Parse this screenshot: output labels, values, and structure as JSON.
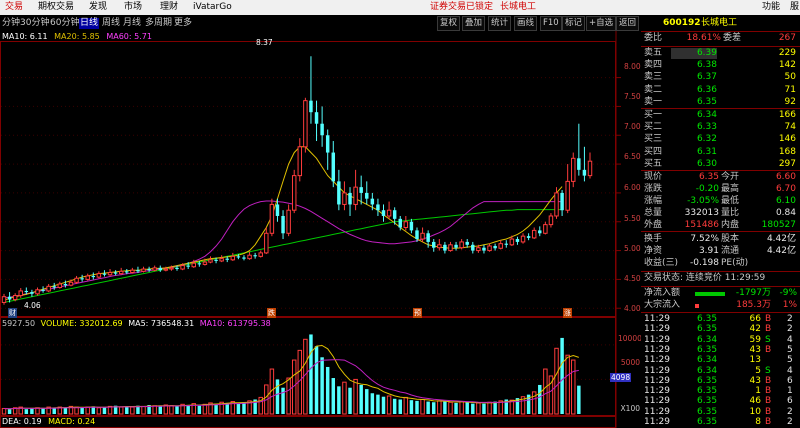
{
  "menu": {
    "items": [
      {
        "label": "交易",
        "active": true
      },
      {
        "label": "期权交易"
      },
      {
        "label": "发现"
      },
      {
        "label": "市场"
      },
      {
        "label": "理财"
      },
      {
        "label": "iVatarGo"
      }
    ],
    "notice_lock": "证券交易已锁定",
    "notice_stock": "长城电工",
    "right": [
      "功能",
      "服"
    ]
  },
  "periods": [
    "分钟",
    "30分钟",
    "60分钟",
    "日线",
    "周线",
    "月线",
    "多周期",
    "更多"
  ],
  "selected_period": "日线",
  "toolbar": [
    "复权",
    "叠加",
    "统计",
    "画线",
    "F10",
    "标记",
    "+自选",
    "返回"
  ],
  "legends": {
    "ma": [
      {
        "text": "MA10: 6.11",
        "color": "#ffffff"
      },
      {
        "text": "MA20: 5.85",
        "color": "#e0c000"
      },
      {
        "text": "MA60: 5.71",
        "color": "#ff40ff"
      }
    ],
    "vol": [
      {
        "text": "5927.50",
        "color": "#c8c8c8"
      },
      {
        "text": "VOLUME: 332012.69",
        "color": "#ffff00"
      },
      {
        "text": "MA5: 736548.31",
        "color": "#ffffff"
      },
      {
        "text": "MA10: 613795.38",
        "color": "#ff40ff"
      }
    ],
    "macd": [
      {
        "text": "DEA: 0.19",
        "color": "#ffffff"
      },
      {
        "text": "MACD: 0.24",
        "color": "#ffff00"
      }
    ]
  },
  "price_axis": [
    "8.00",
    "7.50",
    "7.00",
    "6.50",
    "6.00",
    "5.50",
    "5.00",
    "4.50",
    "4.00"
  ],
  "vol_axis": [
    "10000",
    "5000",
    "X100"
  ],
  "vol_marker": "4098",
  "annotations": {
    "high": "8.37",
    "low": "4.06",
    "markers": [
      "财",
      "跌",
      "预",
      "涨"
    ]
  },
  "chart_data": {
    "type": "candlestick",
    "ylim": [
      3.9,
      8.6
    ],
    "candles": [
      [
        4.1,
        4.2,
        4.25,
        4.06
      ],
      [
        4.2,
        4.15,
        4.28,
        4.1
      ],
      [
        4.15,
        4.22,
        4.26,
        4.12
      ],
      [
        4.22,
        4.3,
        4.35,
        4.18
      ],
      [
        4.3,
        4.28,
        4.36,
        4.24
      ],
      [
        4.28,
        4.25,
        4.32,
        4.2
      ],
      [
        4.25,
        4.32,
        4.36,
        4.22
      ],
      [
        4.32,
        4.3,
        4.38,
        4.27
      ],
      [
        4.3,
        4.38,
        4.42,
        4.28
      ],
      [
        4.38,
        4.36,
        4.44,
        4.32
      ],
      [
        4.36,
        4.42,
        4.46,
        4.34
      ],
      [
        4.42,
        4.4,
        4.48,
        4.36
      ],
      [
        4.4,
        4.45,
        4.5,
        4.38
      ],
      [
        4.45,
        4.52,
        4.56,
        4.42
      ],
      [
        4.52,
        4.5,
        4.58,
        4.46
      ],
      [
        4.5,
        4.56,
        4.6,
        4.48
      ],
      [
        4.56,
        4.54,
        4.62,
        4.5
      ],
      [
        4.54,
        4.6,
        4.64,
        4.52
      ],
      [
        4.6,
        4.58,
        4.66,
        4.55
      ],
      [
        4.58,
        4.62,
        4.68,
        4.56
      ],
      [
        4.62,
        4.6,
        4.66,
        4.57
      ],
      [
        4.6,
        4.64,
        4.7,
        4.58
      ],
      [
        4.64,
        4.62,
        4.68,
        4.59
      ],
      [
        4.62,
        4.66,
        4.7,
        4.6
      ],
      [
        4.66,
        4.64,
        4.72,
        4.61
      ],
      [
        4.64,
        4.68,
        4.72,
        4.62
      ],
      [
        4.68,
        4.66,
        4.72,
        4.63
      ],
      [
        4.66,
        4.7,
        4.74,
        4.64
      ],
      [
        4.7,
        4.66,
        4.74,
        4.63
      ],
      [
        4.66,
        4.68,
        4.72,
        4.64
      ],
      [
        4.68,
        4.7,
        4.74,
        4.65
      ],
      [
        4.7,
        4.68,
        4.74,
        4.65
      ],
      [
        4.68,
        4.74,
        4.78,
        4.66
      ],
      [
        4.74,
        4.72,
        4.8,
        4.68
      ],
      [
        4.72,
        4.78,
        4.84,
        4.7
      ],
      [
        4.78,
        4.76,
        4.82,
        4.72
      ],
      [
        4.76,
        4.8,
        4.86,
        4.74
      ],
      [
        4.8,
        4.84,
        4.9,
        4.78
      ],
      [
        4.84,
        4.82,
        4.88,
        4.78
      ],
      [
        4.82,
        4.86,
        4.92,
        4.8
      ],
      [
        4.86,
        4.84,
        4.9,
        4.8
      ],
      [
        4.84,
        4.9,
        4.96,
        4.82
      ],
      [
        4.9,
        4.88,
        4.94,
        4.85
      ],
      [
        4.88,
        4.86,
        4.92,
        4.83
      ],
      [
        4.86,
        4.92,
        4.98,
        4.84
      ],
      [
        4.92,
        4.9,
        4.96,
        4.86
      ],
      [
        4.9,
        4.96,
        5.0,
        4.88
      ],
      [
        4.96,
        5.3,
        5.4,
        4.94
      ],
      [
        5.3,
        5.8,
        5.9,
        5.25
      ],
      [
        5.8,
        5.6,
        5.9,
        5.5
      ],
      [
        5.6,
        5.3,
        5.7,
        5.2
      ],
      [
        5.3,
        5.7,
        5.8,
        5.25
      ],
      [
        5.7,
        6.3,
        6.4,
        5.65
      ],
      [
        6.3,
        6.8,
        6.95,
        6.2
      ],
      [
        6.8,
        7.6,
        7.65,
        6.7
      ],
      [
        7.6,
        7.4,
        8.37,
        7.2
      ],
      [
        7.4,
        7.2,
        7.6,
        6.9
      ],
      [
        7.2,
        7.0,
        7.5,
        6.8
      ],
      [
        7.0,
        6.7,
        7.1,
        6.4
      ],
      [
        6.7,
        6.2,
        6.9,
        6.1
      ],
      [
        6.2,
        5.8,
        6.4,
        5.7
      ],
      [
        5.8,
        6.0,
        6.2,
        5.7
      ],
      [
        6.0,
        5.8,
        6.1,
        5.6
      ],
      [
        5.8,
        6.1,
        6.4,
        5.7
      ],
      [
        6.1,
        6.0,
        6.3,
        5.8
      ],
      [
        6.0,
        5.9,
        6.2,
        5.8
      ],
      [
        5.9,
        5.8,
        6.0,
        5.7
      ],
      [
        5.8,
        5.7,
        5.9,
        5.6
      ],
      [
        5.7,
        5.6,
        5.8,
        5.5
      ],
      [
        5.6,
        5.7,
        5.85,
        5.55
      ],
      [
        5.7,
        5.55,
        5.75,
        5.45
      ],
      [
        5.55,
        5.4,
        5.6,
        5.35
      ],
      [
        5.4,
        5.5,
        5.6,
        5.35
      ],
      [
        5.5,
        5.35,
        5.55,
        5.3
      ],
      [
        5.35,
        5.2,
        5.4,
        5.15
      ],
      [
        5.2,
        5.3,
        5.4,
        5.15
      ],
      [
        5.3,
        5.15,
        5.35,
        5.05
      ],
      [
        5.15,
        5.05,
        5.2,
        4.98
      ],
      [
        5.05,
        5.1,
        5.2,
        5.0
      ],
      [
        5.1,
        5.0,
        5.15,
        4.95
      ],
      [
        5.0,
        5.1,
        5.15,
        4.98
      ],
      [
        5.1,
        5.05,
        5.15,
        5.0
      ],
      [
        5.05,
        5.15,
        5.2,
        5.02
      ],
      [
        5.15,
        5.1,
        5.2,
        5.05
      ],
      [
        5.1,
        5.0,
        5.15,
        4.95
      ],
      [
        5.0,
        5.05,
        5.1,
        4.96
      ],
      [
        5.05,
        5.0,
        5.1,
        4.95
      ],
      [
        5.0,
        5.08,
        5.12,
        4.98
      ],
      [
        5.08,
        5.04,
        5.12,
        5.0
      ],
      [
        5.04,
        5.12,
        5.18,
        5.02
      ],
      [
        5.12,
        5.1,
        5.18,
        5.05
      ],
      [
        5.1,
        5.2,
        5.26,
        5.08
      ],
      [
        5.2,
        5.15,
        5.24,
        5.1
      ],
      [
        5.15,
        5.25,
        5.3,
        5.12
      ],
      [
        5.25,
        5.22,
        5.3,
        5.18
      ],
      [
        5.22,
        5.35,
        5.4,
        5.2
      ],
      [
        5.35,
        5.3,
        5.42,
        5.25
      ],
      [
        5.3,
        5.45,
        5.5,
        5.28
      ],
      [
        5.45,
        5.6,
        5.65,
        5.4
      ],
      [
        5.6,
        6.0,
        6.1,
        5.55
      ],
      [
        6.0,
        5.7,
        6.05,
        5.6
      ],
      [
        5.7,
        6.2,
        6.5,
        5.65
      ],
      [
        6.2,
        6.6,
        6.7,
        6.1
      ],
      [
        6.6,
        6.4,
        7.2,
        6.3
      ],
      [
        6.4,
        6.3,
        6.8,
        6.2
      ],
      [
        6.3,
        6.55,
        6.7,
        6.25
      ]
    ],
    "ma10": [
      4.14,
      4.17,
      4.2,
      4.22,
      4.24,
      4.27,
      4.3,
      4.33,
      4.36,
      4.39,
      4.42,
      4.45,
      4.48,
      4.51,
      4.54,
      4.56,
      4.58,
      4.6,
      4.61,
      4.62,
      4.63,
      4.64,
      4.65,
      4.66,
      4.66,
      4.67,
      4.68,
      4.69,
      4.69,
      4.7,
      4.72,
      4.74,
      4.76,
      4.78,
      4.8,
      4.82,
      4.84,
      4.86,
      4.87,
      4.88,
      4.89,
      4.9,
      4.92,
      4.95,
      5.0,
      5.1,
      5.25,
      5.4,
      5.6,
      5.9,
      6.2,
      6.5,
      6.7,
      6.8,
      6.8,
      6.7,
      6.6,
      6.45,
      6.3,
      6.2,
      6.1,
      6.0,
      5.95,
      5.9,
      5.85,
      5.8,
      5.75,
      5.7,
      5.62,
      5.55,
      5.48,
      5.4,
      5.33,
      5.26,
      5.2,
      5.15,
      5.1,
      5.08,
      5.06,
      5.05,
      5.04,
      5.04,
      5.05,
      5.06,
      5.07,
      5.08,
      5.1,
      5.12,
      5.15,
      5.18,
      5.2,
      5.24,
      5.28,
      5.34,
      5.42,
      5.52,
      5.62,
      5.75,
      5.88,
      6.0,
      6.11
    ],
    "ma20": [
      4.18,
      4.19,
      4.21,
      4.23,
      4.25,
      4.27,
      4.29,
      4.31,
      4.33,
      4.35,
      4.37,
      4.39,
      4.41,
      4.43,
      4.45,
      4.47,
      4.49,
      4.51,
      4.53,
      4.55,
      4.57,
      4.58,
      4.6,
      4.61,
      4.62,
      4.64,
      4.65,
      4.67,
      4.68,
      4.7,
      4.71,
      4.73,
      4.75,
      4.78,
      4.81,
      4.85,
      4.9,
      4.98,
      5.08,
      5.2,
      5.35,
      5.5,
      5.62,
      5.72,
      5.78,
      5.82,
      5.85,
      5.86,
      5.86,
      5.85,
      5.84,
      5.82,
      5.8,
      5.77,
      5.73,
      5.68,
      5.62,
      5.56,
      5.5,
      5.44,
      5.38,
      5.33,
      5.28,
      5.24,
      5.2,
      5.17,
      5.15,
      5.14,
      5.13,
      5.12,
      5.12,
      5.13,
      5.14,
      5.15,
      5.17,
      5.2,
      5.23,
      5.27,
      5.31,
      5.36,
      5.42,
      5.5,
      5.58,
      5.66,
      5.74,
      5.8,
      5.85,
      5.85,
      5.85,
      5.85,
      5.85,
      5.85,
      5.85,
      5.85,
      5.85,
      5.85,
      5.85,
      5.85,
      5.85,
      5.85,
      5.85
    ],
    "ma60": [
      4.1,
      4.12,
      4.14,
      4.16,
      4.18,
      4.2,
      4.22,
      4.24,
      4.26,
      4.28,
      4.3,
      4.32,
      4.34,
      4.36,
      4.38,
      4.4,
      4.42,
      4.44,
      4.46,
      4.48,
      4.5,
      4.52,
      4.54,
      4.56,
      4.58,
      4.6,
      4.62,
      4.64,
      4.66,
      4.68,
      4.7,
      4.72,
      4.74,
      4.76,
      4.78,
      4.8,
      4.82,
      4.84,
      4.86,
      4.88,
      4.9,
      4.92,
      4.94,
      4.96,
      4.98,
      5.0,
      5.02,
      5.04,
      5.06,
      5.08,
      5.1,
      5.12,
      5.14,
      5.16,
      5.18,
      5.2,
      5.22,
      5.24,
      5.26,
      5.28,
      5.3,
      5.32,
      5.34,
      5.36,
      5.38,
      5.4,
      5.42,
      5.44,
      5.46,
      5.48,
      5.5,
      5.51,
      5.52,
      5.53,
      5.54,
      5.55,
      5.56,
      5.57,
      5.58,
      5.59,
      5.6,
      5.61,
      5.62,
      5.63,
      5.64,
      5.65,
      5.66,
      5.67,
      5.68,
      5.69,
      5.7,
      5.7,
      5.71,
      5.71,
      5.71,
      5.71,
      5.71,
      5.71,
      5.71,
      5.71,
      5.71
    ],
    "volumes": [
      800,
      700,
      900,
      1000,
      700,
      800,
      900,
      800,
      1000,
      900,
      1000,
      900,
      1100,
      1000,
      900,
      1000,
      1100,
      900,
      1000,
      1100,
      1200,
      1000,
      1100,
      1000,
      1200,
      1100,
      1300,
      1200,
      1100,
      1300,
      1200,
      1100,
      1400,
      1300,
      1500,
      1200,
      1400,
      1600,
      1500,
      1700,
      1600,
      1800,
      1500,
      1700,
      1900,
      2100,
      2400,
      4200,
      6500,
      5000,
      3800,
      5200,
      7800,
      9200,
      10800,
      11500,
      9800,
      8200,
      6800,
      5200,
      4000,
      4600,
      3800,
      5000,
      4200,
      3600,
      3000,
      2800,
      2500,
      2600,
      2200,
      2100,
      2400,
      2000,
      1900,
      2100,
      1800,
      1700,
      1900,
      1800,
      1700,
      1600,
      1800,
      1700,
      1500,
      1600,
      1500,
      1700,
      1800,
      1900,
      2100,
      2000,
      2300,
      2500,
      2800,
      3200,
      4200,
      6500,
      5500,
      9500,
      11000,
      8500,
      7800,
      4098
    ]
  },
  "right_panel": {
    "code": "600192",
    "name": "长城电工",
    "wb_label": "委比",
    "wb_val": "18.61%",
    "wc_label": "委差",
    "wc_val": "267",
    "asks": [
      {
        "label": "卖五",
        "price": "6.39",
        "vol": "229"
      },
      {
        "label": "卖四",
        "price": "6.38",
        "vol": "142"
      },
      {
        "label": "卖三",
        "price": "6.37",
        "vol": "50"
      },
      {
        "label": "卖二",
        "price": "6.36",
        "vol": "71"
      },
      {
        "label": "卖一",
        "price": "6.35",
        "vol": "92"
      }
    ],
    "bids": [
      {
        "label": "买一",
        "price": "6.34",
        "vol": "166"
      },
      {
        "label": "买二",
        "price": "6.33",
        "vol": "74"
      },
      {
        "label": "买三",
        "price": "6.32",
        "vol": "146"
      },
      {
        "label": "买四",
        "price": "6.31",
        "vol": "168"
      },
      {
        "label": "买五",
        "price": "6.30",
        "vol": "297"
      }
    ],
    "quote": [
      {
        "l1": "现价",
        "v1": "6.35",
        "c1": "red",
        "l2": "今开",
        "v2": "6.60",
        "c2": "red"
      },
      {
        "l1": "涨跌",
        "v1": "-0.20",
        "c1": "green",
        "l2": "最高",
        "v2": "6.70",
        "c2": "red"
      },
      {
        "l1": "涨幅",
        "v1": "-3.05%",
        "c1": "green",
        "l2": "最低",
        "v2": "6.10",
        "c2": "green"
      },
      {
        "l1": "总量",
        "v1": "332013",
        "c1": "white",
        "l2": "量比",
        "v2": "0.84",
        "c2": "white"
      },
      {
        "l1": "外盘",
        "v1": "151486",
        "c1": "red",
        "l2": "内盘",
        "v2": "180527",
        "c2": "green"
      }
    ],
    "stats": [
      {
        "l1": "换手",
        "v1": "7.52%",
        "l2": "股本",
        "v2": "4.42亿"
      },
      {
        "l1": "净资",
        "v1": "3.91",
        "l2": "流通",
        "v2": "4.42亿"
      },
      {
        "l1": "收益(三)",
        "v1": "-0.198",
        "l2": "PE(动)",
        "v2": ""
      }
    ],
    "status": "交易状态: 连续竞价 11:29:59",
    "flow": [
      {
        "label": "净流入额",
        "bar_fraction": 0.75,
        "bar_color": "#00c800",
        "val": "-1797万",
        "c": "green",
        "pct": "-9%",
        "pc": "green"
      },
      {
        "label": "大宗流入",
        "bar_fraction": 0.1,
        "bar_color": "#ff3c3c",
        "val": "185.3万",
        "c": "red",
        "pct": "1%",
        "pc": "red"
      }
    ],
    "ticks": [
      {
        "t": "11:29",
        "p": "6.35",
        "v": "66",
        "d": "B",
        "n": "2"
      },
      {
        "t": "11:29",
        "p": "6.35",
        "v": "42",
        "d": "B",
        "n": "2"
      },
      {
        "t": "11:29",
        "p": "6.34",
        "v": "59",
        "d": "S",
        "n": "4"
      },
      {
        "t": "11:29",
        "p": "6.35",
        "v": "43",
        "d": "B",
        "n": "5"
      },
      {
        "t": "11:29",
        "p": "6.34",
        "v": "13",
        "d": "",
        "n": "5"
      },
      {
        "t": "11:29",
        "p": "6.34",
        "v": "5",
        "d": "S",
        "n": "4"
      },
      {
        "t": "11:29",
        "p": "6.35",
        "v": "43",
        "d": "B",
        "n": "6"
      },
      {
        "t": "11:29",
        "p": "6.35",
        "v": "1",
        "d": "B",
        "n": "1"
      },
      {
        "t": "11:29",
        "p": "6.35",
        "v": "46",
        "d": "B",
        "n": "6"
      },
      {
        "t": "11:29",
        "p": "6.35",
        "v": "10",
        "d": "B",
        "n": "2"
      },
      {
        "t": "11:29",
        "p": "6.35",
        "v": "8",
        "d": "B",
        "n": "2"
      }
    ]
  }
}
